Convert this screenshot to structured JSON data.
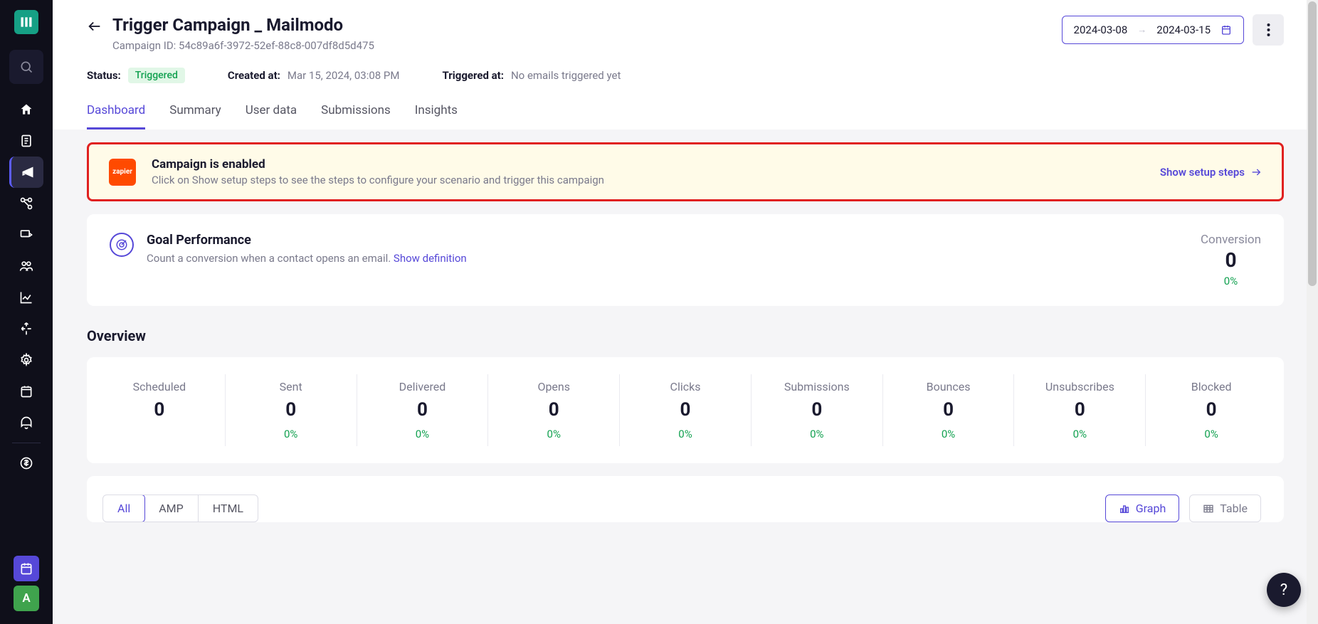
{
  "header": {
    "title": "Trigger Campaign _ Mailmodo",
    "campaign_id_label": "Campaign ID: ",
    "campaign_id": "54c89a6f-3972-52ef-88c8-007df8d5d475",
    "date_from": "2024-03-08",
    "date_to": "2024-03-15"
  },
  "meta": {
    "status_label": "Status:",
    "status_value": "Triggered",
    "created_label": "Created at:",
    "created_value": "Mar 15, 2024, 03:08 PM",
    "triggered_label": "Triggered at:",
    "triggered_value": "No emails triggered yet"
  },
  "tabs": [
    "Dashboard",
    "Summary",
    "User data",
    "Submissions",
    "Insights"
  ],
  "banner": {
    "integration": "zapier",
    "title": "Campaign is enabled",
    "desc": "Click on Show setup steps to see the steps to configure your scenario and trigger this campaign",
    "link": "Show setup steps"
  },
  "goal": {
    "title": "Goal Performance",
    "desc": "Count a conversion when a contact opens an email. ",
    "definition_link": "Show definition",
    "conversion_label": "Conversion",
    "conversion_value": "0",
    "conversion_pct": "0%"
  },
  "overview_title": "Overview",
  "stats": [
    {
      "label": "Scheduled",
      "value": "0",
      "pct": ""
    },
    {
      "label": "Sent",
      "value": "0",
      "pct": "0%"
    },
    {
      "label": "Delivered",
      "value": "0",
      "pct": "0%"
    },
    {
      "label": "Opens",
      "value": "0",
      "pct": "0%"
    },
    {
      "label": "Clicks",
      "value": "0",
      "pct": "0%"
    },
    {
      "label": "Submissions",
      "value": "0",
      "pct": "0%"
    },
    {
      "label": "Bounces",
      "value": "0",
      "pct": "0%"
    },
    {
      "label": "Unsubscribes",
      "value": "0",
      "pct": "0%"
    },
    {
      "label": "Blocked",
      "value": "0",
      "pct": "0%"
    }
  ],
  "viewtabs": [
    "All",
    "AMP",
    "HTML"
  ],
  "view_toggle": {
    "graph": "Graph",
    "table": "Table"
  },
  "avatar_letter": "A",
  "help_symbol": "?"
}
